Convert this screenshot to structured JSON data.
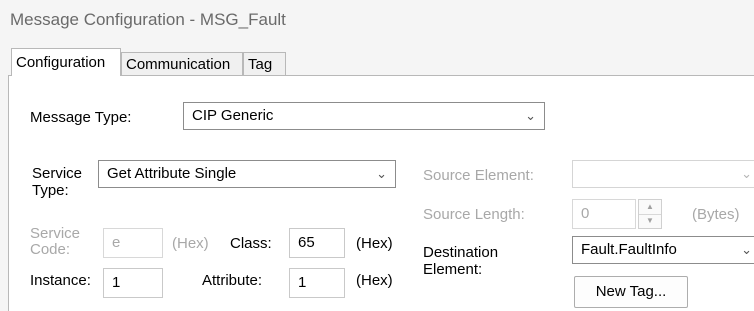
{
  "window": {
    "title": "Message Configuration - MSG_Fault"
  },
  "tabs": [
    {
      "label": "Configuration",
      "active": true
    },
    {
      "label": "Communication",
      "active": false
    },
    {
      "label": "Tag",
      "active": false
    }
  ],
  "message_type": {
    "label": "Message Type:",
    "value": "CIP Generic"
  },
  "service_type": {
    "label": "Service Type:",
    "value": "Get Attribute Single"
  },
  "service_code": {
    "label": "Service Code:",
    "value": "e",
    "unit": "(Hex)"
  },
  "class": {
    "label": "Class:",
    "value": "65",
    "unit": "(Hex)"
  },
  "instance": {
    "label": "Instance:",
    "value": "1"
  },
  "attribute": {
    "label": "Attribute:",
    "value": "1",
    "unit": "(Hex)"
  },
  "source_element": {
    "label": "Source Element:",
    "value": ""
  },
  "source_length": {
    "label": "Source Length:",
    "value": "0",
    "unit": "(Bytes)"
  },
  "destination_element": {
    "label": "Destination Element:",
    "value": "Fault.FaultInfo"
  },
  "new_tag_button": {
    "label": "New Tag..."
  },
  "icons": {
    "dropdown": "chevron-down-icon",
    "spin_up": "spin-up-icon",
    "spin_down": "spin-down-icon"
  }
}
